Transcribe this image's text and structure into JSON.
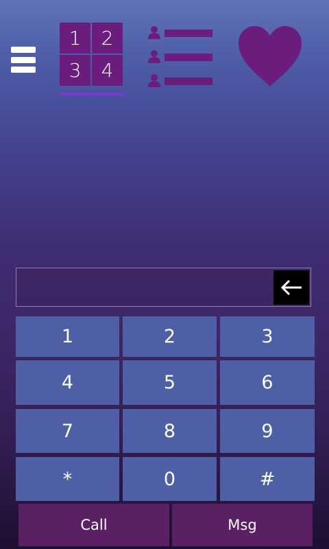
{
  "toolbar": {
    "menu_icon": "hamburger-menu-icon",
    "dialpad_tab": {
      "tiles": [
        "1",
        "2",
        "3",
        "4"
      ]
    },
    "contacts_tab": {
      "icon": "contact-list-icon"
    },
    "favorites_tab": {
      "icon": "heart-icon"
    }
  },
  "display": {
    "number": "",
    "backspace_icon": "backspace-arrow-icon"
  },
  "keypad": {
    "keys": [
      "1",
      "2",
      "3",
      "4",
      "5",
      "6",
      "7",
      "8",
      "9",
      "*",
      "0",
      "#"
    ]
  },
  "actions": {
    "call_label": "Call",
    "msg_label": "Msg"
  },
  "colors": {
    "tile_purple": "#6b1d7d",
    "tab_underline": "#7b3bd0",
    "key_blue": "#4f5fa5",
    "action_purple": "#5a2063",
    "backspace_bg": "#000000"
  }
}
